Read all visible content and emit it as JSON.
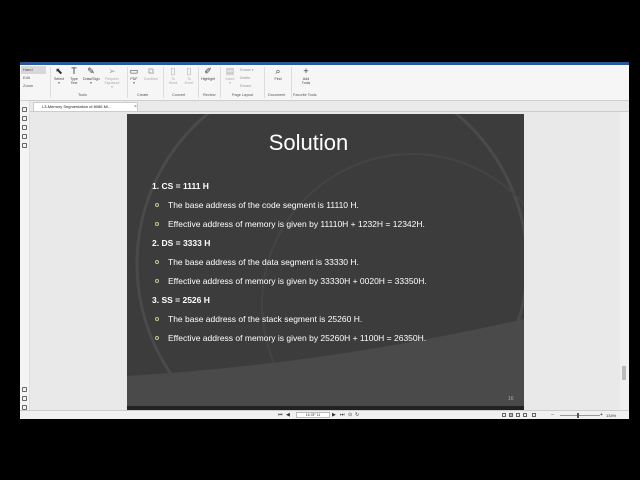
{
  "ribbon": {
    "left_tools": [
      "Hand",
      "Edit",
      "Zoom"
    ],
    "tools": [
      {
        "icon": "select-icon",
        "label": "Select\n▾"
      },
      {
        "icon": "type-icon",
        "label": "Type\nText"
      },
      {
        "icon": "pen-icon",
        "label": "Draw/Sign\n▾"
      },
      {
        "icon": "request-signature-icon",
        "label": "Request\nSignature ▾"
      },
      {
        "icon": "pdf-icon",
        "label": "PDF\n▾"
      },
      {
        "icon": "combine-icon",
        "label": "Combine"
      },
      {
        "icon": "to-word-icon",
        "label": "To\nWord"
      },
      {
        "icon": "to-excel-icon",
        "label": "To\nExcel"
      },
      {
        "icon": "highlight-icon",
        "label": "Highlight"
      },
      {
        "icon": "insert-icon",
        "label": "Insert\n▾"
      },
      {
        "icon": "find-icon",
        "label": "Find"
      },
      {
        "icon": "add-tools-icon",
        "label": "Add\nTools"
      }
    ],
    "mini_labels": [
      "Rotate ▾",
      "Delete",
      "Extract"
    ],
    "groups": [
      "Tools",
      "Create",
      "Convert",
      "Review",
      "Page Layout",
      "Document",
      "Favorite Tools"
    ]
  },
  "tab": {
    "label": "L3-Memory Segmentation of 8086 Mi..."
  },
  "slide": {
    "title": "Solution",
    "sections": [
      {
        "heading": "1. CS = 1111 H",
        "bullets": [
          "The base address of the code segment is 11110 H.",
          "Effective address of memory is given by 11110H + 1232H = 12342H."
        ]
      },
      {
        "heading": "2. DS = 3333 H",
        "bullets": [
          "The base address of the data segment is 33330 H.",
          "Effective address of memory is given by 33330H + 0020H = 33350H."
        ]
      },
      {
        "heading": "3. SS = 2526 H",
        "bullets": [
          "The base address of the stack segment is 25260 H.",
          "Effective address of memory is given by 25260H + 1100H = 26350H."
        ]
      }
    ],
    "number": "16"
  },
  "status": {
    "page": "16 OF 11",
    "zoom": "134%"
  },
  "colors": {
    "slide_bg": "#3c3c3c",
    "bullet": "#b8c98f",
    "accent": "#2b5797"
  }
}
